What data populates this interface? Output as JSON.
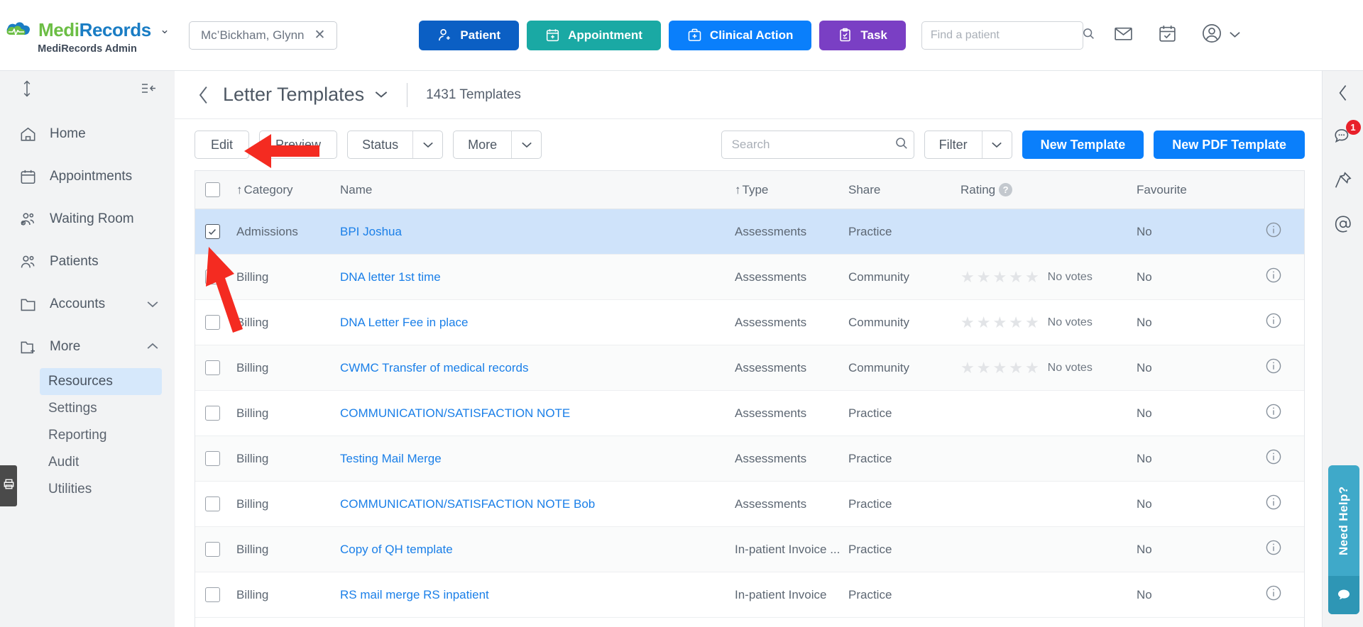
{
  "brand": {
    "name_part1": "Medi",
    "name_part2": "Records",
    "subtitle": "MediRecords Admin",
    "caret": "⌄"
  },
  "patient_chip": {
    "name": "Mc’Bickham, Glynn",
    "close": "✕"
  },
  "topnav": [
    {
      "label": "Patient",
      "icon": "person-add-icon",
      "color": "#0b5fc4"
    },
    {
      "label": "Appointment",
      "icon": "calendar-add-icon",
      "color": "#1aa9a4"
    },
    {
      "label": "Clinical Action",
      "icon": "briefcase-add-icon",
      "color": "#0a7ffb"
    },
    {
      "label": "Task",
      "icon": "clipboard-check-icon",
      "color": "#7a3fc4"
    }
  ],
  "find_patient": {
    "placeholder": "Find a patient",
    "value": ""
  },
  "top_icons": [
    {
      "name": "mail-icon"
    },
    {
      "name": "calendar-check-icon"
    },
    {
      "name": "account-circle-icon"
    },
    {
      "name": "chevron-down-icon"
    }
  ],
  "sidebar": {
    "resize_icon": "vertical-resize-icon",
    "collapse_icon": "collapse-menu-icon",
    "items": [
      {
        "label": "Home",
        "icon": "home-icon",
        "expandable": false,
        "active": false
      },
      {
        "label": "Appointments",
        "icon": "calendar-icon",
        "expandable": false,
        "active": false
      },
      {
        "label": "Waiting Room",
        "icon": "waiting-room-icon",
        "expandable": false,
        "active": false
      },
      {
        "label": "Patients",
        "icon": "people-icon",
        "expandable": false,
        "active": false
      },
      {
        "label": "Accounts",
        "icon": "folder-icon",
        "expandable": true,
        "expanded": false,
        "chevron": "⌄"
      },
      {
        "label": "More",
        "icon": "folder-add-icon",
        "expandable": true,
        "expanded": true,
        "chevron": "⌃"
      }
    ],
    "sub_items": [
      {
        "label": "Resources",
        "active": true
      },
      {
        "label": "Settings",
        "active": false
      },
      {
        "label": "Reporting",
        "active": false
      },
      {
        "label": "Audit",
        "active": false
      },
      {
        "label": "Utilities",
        "active": false
      }
    ],
    "print_tab_icon": "print-icon"
  },
  "page": {
    "back_icon": "chevron-left-icon",
    "title": "Letter Templates",
    "title_caret": "⌄",
    "count": "1431 Templates"
  },
  "toolbar": {
    "edit_label": "Edit",
    "preview_label": "Preview",
    "status_label": "Status",
    "more_label": "More",
    "caret": "⌄",
    "search": {
      "placeholder": "Search",
      "value": ""
    },
    "filter_label": "Filter",
    "new_template_label": "New Template",
    "new_pdf_template_label": "New PDF Template"
  },
  "table": {
    "columns": {
      "category": "Category",
      "name": "Name",
      "type": "Type",
      "share": "Share",
      "rating": "Rating",
      "favourite": "Favourite",
      "rating_help": "?",
      "sort_arrow": "↑"
    },
    "rows": [
      {
        "checked": true,
        "category": "Admissions",
        "name": "BPI Joshua",
        "type": "Assessments",
        "share": "Practice",
        "rating": null,
        "favourite": "No"
      },
      {
        "checked": false,
        "category": "Billing",
        "name": "DNA letter 1st time",
        "type": "Assessments",
        "share": "Community",
        "rating": "No votes",
        "favourite": "No"
      },
      {
        "checked": false,
        "category": "Billing",
        "name": "DNA Letter Fee in place",
        "type": "Assessments",
        "share": "Community",
        "rating": "No votes",
        "favourite": "No"
      },
      {
        "checked": false,
        "category": "Billing",
        "name": "CWMC Transfer of medical records",
        "type": "Assessments",
        "share": "Community",
        "rating": "No votes",
        "favourite": "No"
      },
      {
        "checked": false,
        "category": "Billing",
        "name": "COMMUNICATION/SATISFACTION NOTE",
        "type": "Assessments",
        "share": "Practice",
        "rating": null,
        "favourite": "No"
      },
      {
        "checked": false,
        "category": "Billing",
        "name": "Testing Mail Merge",
        "type": "Assessments",
        "share": "Practice",
        "rating": null,
        "favourite": "No"
      },
      {
        "checked": false,
        "category": "Billing",
        "name": "COMMUNICATION/SATISFACTION NOTE Bob",
        "type": "Assessments",
        "share": "Practice",
        "rating": null,
        "favourite": "No"
      },
      {
        "checked": false,
        "category": "Billing",
        "name": "Copy of QH template",
        "type": "In-patient Invoice ...",
        "share": "Practice",
        "rating": null,
        "favourite": "No"
      },
      {
        "checked": false,
        "category": "Billing",
        "name": "RS mail merge RS inpatient",
        "type": "In-patient Invoice",
        "share": "Practice",
        "rating": null,
        "favourite": "No"
      }
    ],
    "star_count": 5,
    "info_icon": "info-circle-icon"
  },
  "rail": {
    "collapse_icon": "chevron-left-icon",
    "chat_icon": "chat-bubble-icon",
    "chat_badge": "1",
    "pin_icon": "pin-icon",
    "mention_icon": "at-mention-icon",
    "need_help_label": "Need Help?",
    "need_help_icon": "chat-bubble-filled-icon"
  },
  "colors": {
    "brand_green": "#6cbe45",
    "brand_blue": "#1a7dc4",
    "primary": "#0a7ffb",
    "selected_row": "#cfe3fa",
    "badge_red": "#e8202a",
    "help_teal": "#3fa9c9",
    "annotation_red": "#f42b21"
  }
}
